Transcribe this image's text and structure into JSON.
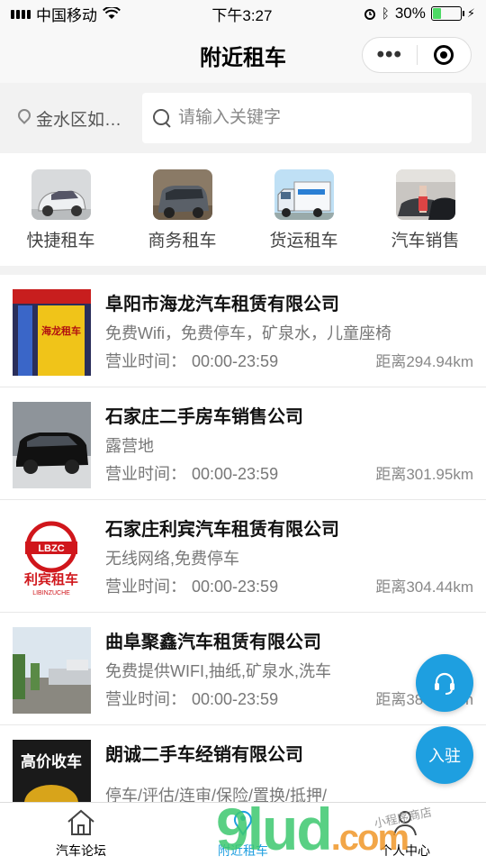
{
  "status": {
    "carrier": "中国移动",
    "time": "下午3:27",
    "battery": "30%"
  },
  "nav": {
    "title": "附近租车",
    "menu": "•••"
  },
  "search": {
    "location": "金水区如…",
    "placeholder": "请输入关键字"
  },
  "categories": [
    {
      "label": "快捷租车",
      "icon": "car-photo"
    },
    {
      "label": "商务租车",
      "icon": "van-photo"
    },
    {
      "label": "货运租车",
      "icon": "truck-photo"
    },
    {
      "label": "汽车销售",
      "icon": "showroom-photo"
    }
  ],
  "hours_label": "营业时间：",
  "items": [
    {
      "name": "阜阳市海龙汽车租赁有限公司",
      "services": "免费Wifi，免费停车，矿泉水，儿童座椅",
      "hours": "00:00-23:59",
      "distance": "距离294.94km"
    },
    {
      "name": "石家庄二手房车销售公司",
      "services": "露营地",
      "hours": "00:00-23:59",
      "distance": "距离301.95km"
    },
    {
      "name": "石家庄利宾汽车租赁有限公司",
      "services": "无线网络,免费停车",
      "hours": "00:00-23:59",
      "distance": "距离304.44km"
    },
    {
      "name": "曲阜聚鑫汽车租赁有限公司",
      "services": "免费提供WIFI,抽纸,矿泉水,洗车",
      "hours": "00:00-23:59",
      "distance": "距离380.05km"
    },
    {
      "name": "朗诚二手车经销有限公司",
      "services": "停车/评估/连审/保险/置换/抵押/",
      "hours": "",
      "distance": ""
    }
  ],
  "logo_text": {
    "lbzc": "LBZC",
    "cn": "利宾租车",
    "en": "LIBINZUCHE"
  },
  "sign_text": {
    "a": "海龙租车",
    "b": "高价收车"
  },
  "fab": {
    "join": "入驻"
  },
  "tabs": [
    {
      "label": "汽车论坛"
    },
    {
      "label": "附近租车"
    },
    {
      "label": "个人中心"
    }
  ],
  "watermark": {
    "main": "9lud",
    "dom": ".com",
    "small": "小程序商店"
  },
  "colors": {
    "accent": "#1e9fe0",
    "logo_red": "#d0161b"
  }
}
